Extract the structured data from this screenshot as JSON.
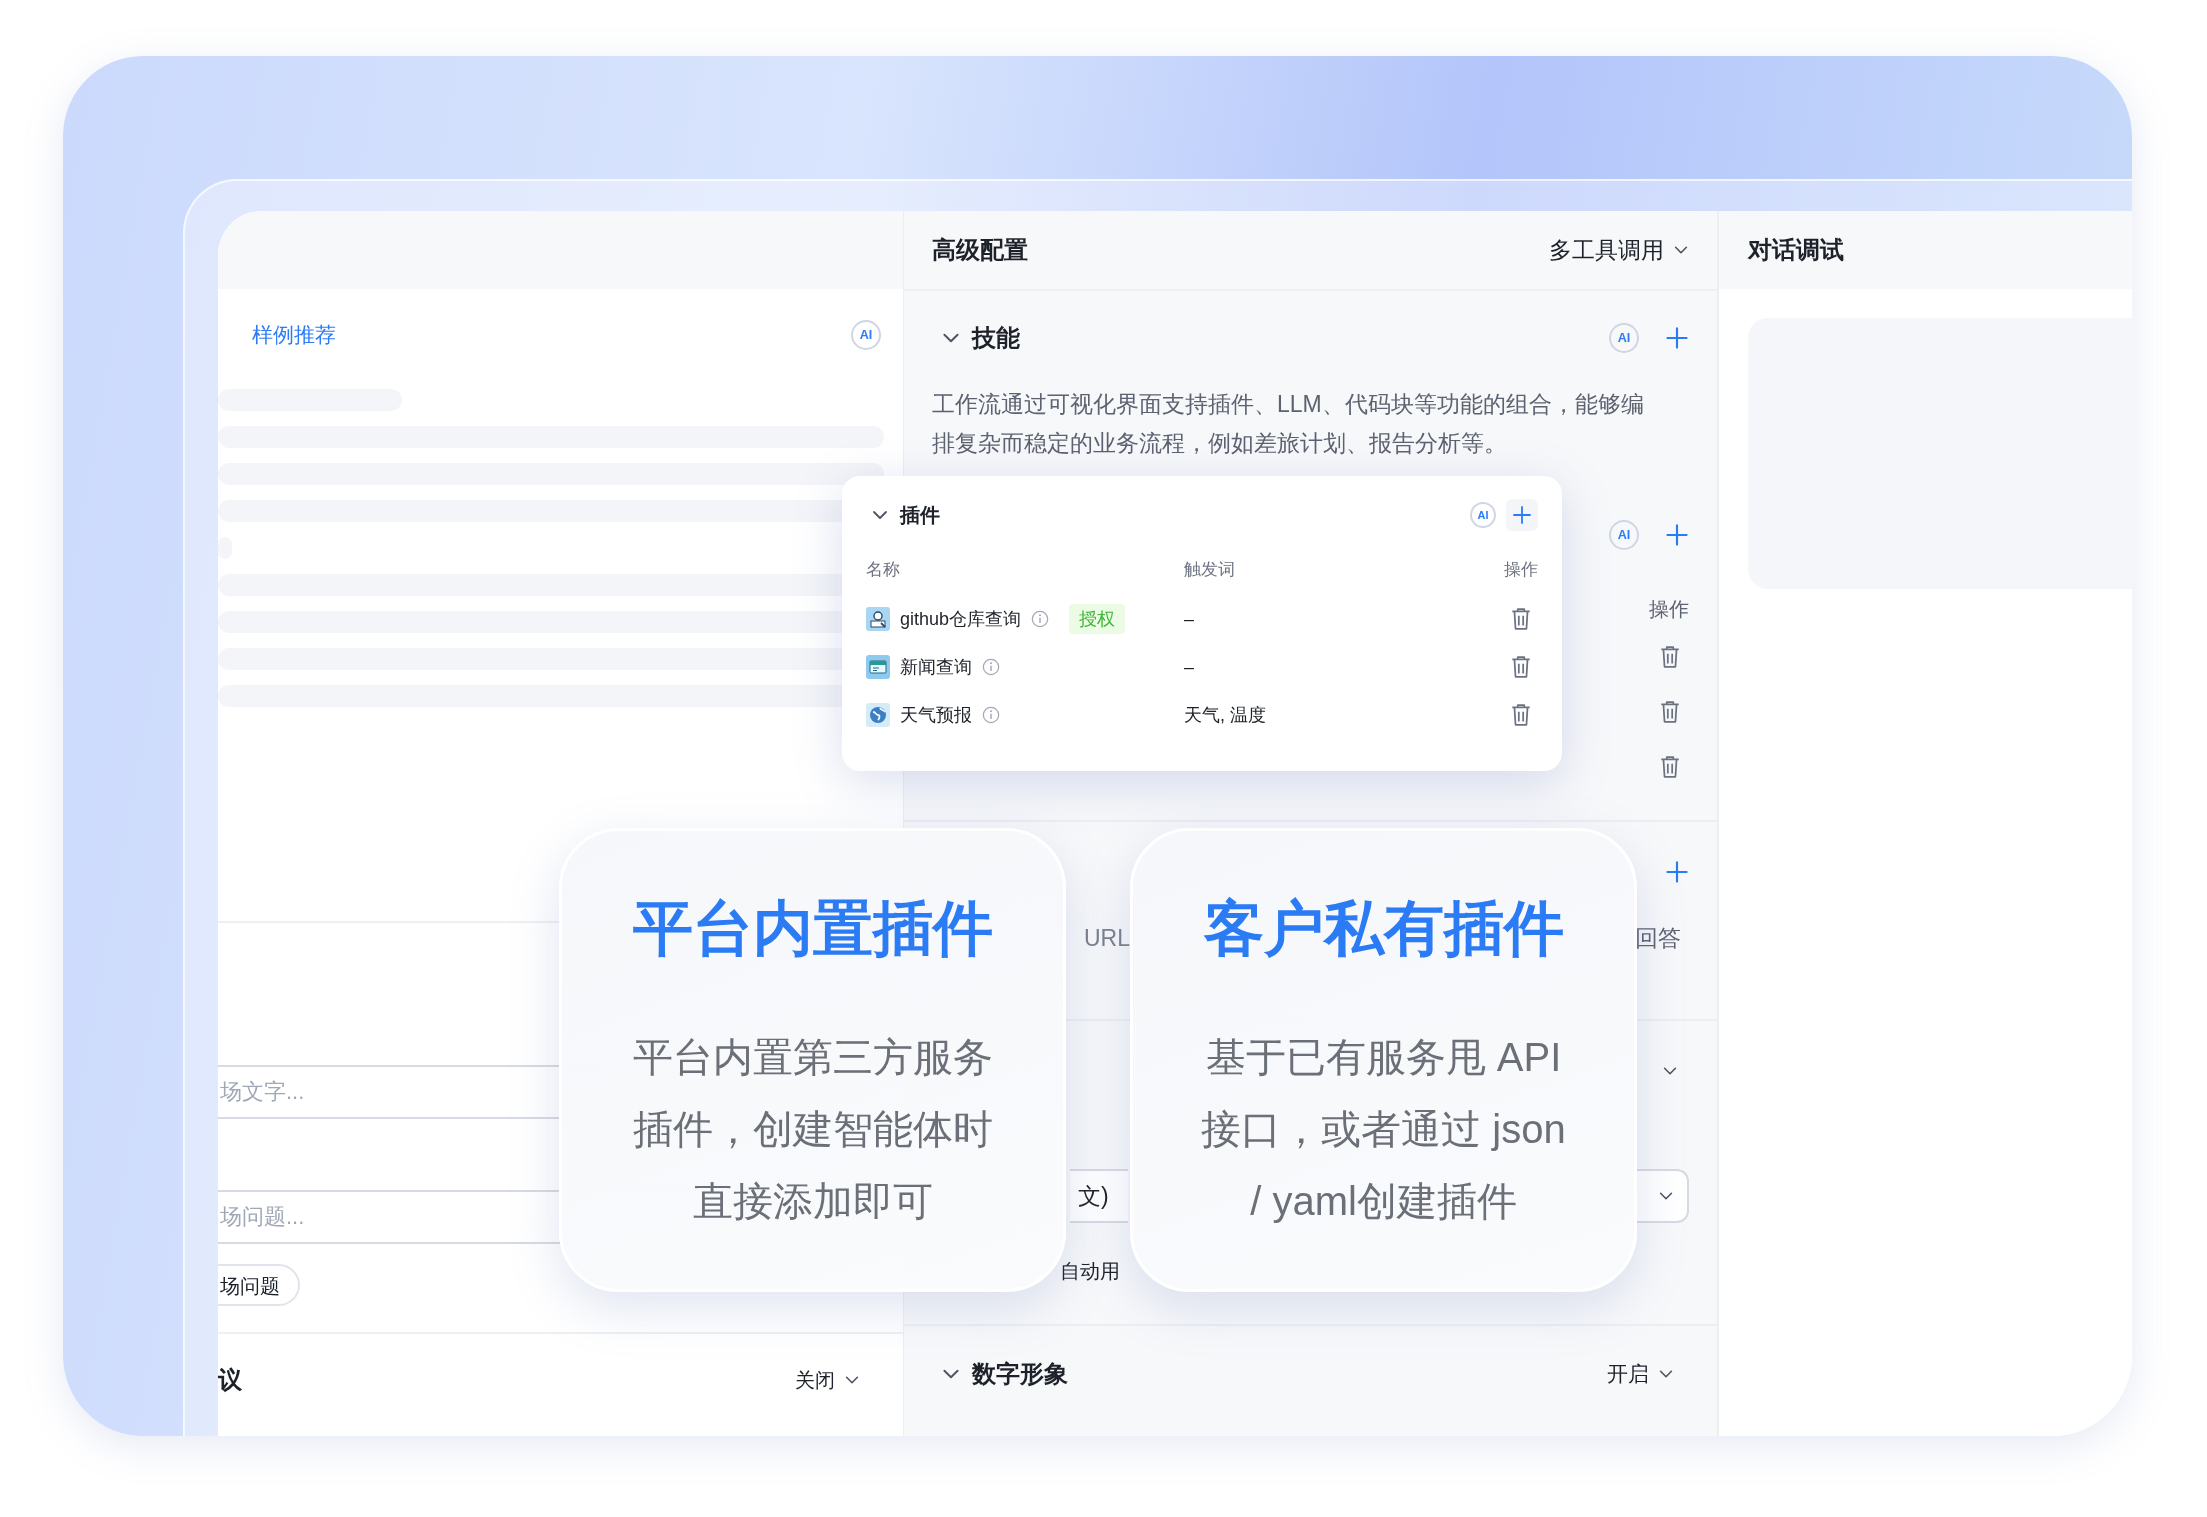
{
  "left_panel": {
    "section_title": "样例推荐",
    "ai_label": "AI",
    "opening_text": {
      "placeholder": "场文字..."
    },
    "opening_questions": {
      "placeholder": "场问题..."
    },
    "question_chip": "场问题",
    "suggestions": {
      "title": "议",
      "value": "关闭"
    }
  },
  "config_panel": {
    "title": "高级配置",
    "mode": "多工具调用",
    "skills": {
      "title": "技能",
      "expanded": true,
      "ai_label": "AI",
      "description": "工作流通过可视化界面支持插件、LLM、代码块等功能的组合，能够编排复杂而稳定的业务流程，例如差旅计划、报告分析等。"
    },
    "plugins": {
      "ai_label": "AI",
      "action_header": "操作"
    },
    "knowledge": {
      "url_fragment": "URL",
      "answer_fragment": "回答"
    },
    "voice": {
      "select_value": "文)",
      "auto_play_fragment": "自动用"
    },
    "avatar": {
      "title": "数字形象",
      "expanded": true,
      "value": "开启"
    }
  },
  "debug_panel": {
    "title": "对话调试"
  },
  "plugin_popup": {
    "title": "插件",
    "expanded": true,
    "ai_label": "AI",
    "columns": [
      "名称",
      "触发词",
      "操作"
    ],
    "plugins": [
      {
        "kind": "search",
        "name": "github仓库查询",
        "badge": "授权",
        "trigger": "–"
      },
      {
        "kind": "news",
        "name": "新闻查询",
        "trigger": "–"
      },
      {
        "kind": "globe",
        "name": "天气预报",
        "trigger": "天气, 温度"
      }
    ]
  },
  "promo_cards": [
    {
      "title": "平台内置插件",
      "lines": [
        "平台内置第三方服务",
        "插件，创建智能体时",
        "直接添加即可"
      ]
    },
    {
      "title": "客户私有插件",
      "lines": [
        "基于已有服务甩 API",
        "接口，或者通过 json",
        "/ yaml创建插件"
      ]
    }
  ]
}
